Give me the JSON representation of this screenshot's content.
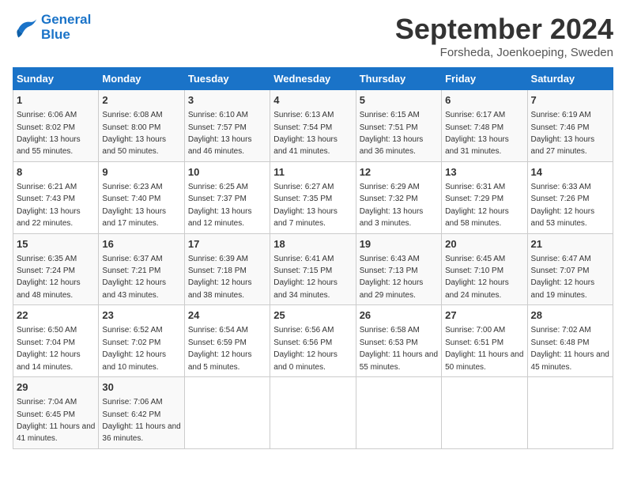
{
  "header": {
    "logo_line1": "General",
    "logo_line2": "Blue",
    "month": "September 2024",
    "location": "Forsheda, Joenkoeping, Sweden"
  },
  "weekdays": [
    "Sunday",
    "Monday",
    "Tuesday",
    "Wednesday",
    "Thursday",
    "Friday",
    "Saturday"
  ],
  "weeks": [
    [
      {
        "day": "1",
        "sunrise": "Sunrise: 6:06 AM",
        "sunset": "Sunset: 8:02 PM",
        "daylight": "Daylight: 13 hours and 55 minutes."
      },
      {
        "day": "2",
        "sunrise": "Sunrise: 6:08 AM",
        "sunset": "Sunset: 8:00 PM",
        "daylight": "Daylight: 13 hours and 50 minutes."
      },
      {
        "day": "3",
        "sunrise": "Sunrise: 6:10 AM",
        "sunset": "Sunset: 7:57 PM",
        "daylight": "Daylight: 13 hours and 46 minutes."
      },
      {
        "day": "4",
        "sunrise": "Sunrise: 6:13 AM",
        "sunset": "Sunset: 7:54 PM",
        "daylight": "Daylight: 13 hours and 41 minutes."
      },
      {
        "day": "5",
        "sunrise": "Sunrise: 6:15 AM",
        "sunset": "Sunset: 7:51 PM",
        "daylight": "Daylight: 13 hours and 36 minutes."
      },
      {
        "day": "6",
        "sunrise": "Sunrise: 6:17 AM",
        "sunset": "Sunset: 7:48 PM",
        "daylight": "Daylight: 13 hours and 31 minutes."
      },
      {
        "day": "7",
        "sunrise": "Sunrise: 6:19 AM",
        "sunset": "Sunset: 7:46 PM",
        "daylight": "Daylight: 13 hours and 27 minutes."
      }
    ],
    [
      {
        "day": "8",
        "sunrise": "Sunrise: 6:21 AM",
        "sunset": "Sunset: 7:43 PM",
        "daylight": "Daylight: 13 hours and 22 minutes."
      },
      {
        "day": "9",
        "sunrise": "Sunrise: 6:23 AM",
        "sunset": "Sunset: 7:40 PM",
        "daylight": "Daylight: 13 hours and 17 minutes."
      },
      {
        "day": "10",
        "sunrise": "Sunrise: 6:25 AM",
        "sunset": "Sunset: 7:37 PM",
        "daylight": "Daylight: 13 hours and 12 minutes."
      },
      {
        "day": "11",
        "sunrise": "Sunrise: 6:27 AM",
        "sunset": "Sunset: 7:35 PM",
        "daylight": "Daylight: 13 hours and 7 minutes."
      },
      {
        "day": "12",
        "sunrise": "Sunrise: 6:29 AM",
        "sunset": "Sunset: 7:32 PM",
        "daylight": "Daylight: 13 hours and 3 minutes."
      },
      {
        "day": "13",
        "sunrise": "Sunrise: 6:31 AM",
        "sunset": "Sunset: 7:29 PM",
        "daylight": "Daylight: 12 hours and 58 minutes."
      },
      {
        "day": "14",
        "sunrise": "Sunrise: 6:33 AM",
        "sunset": "Sunset: 7:26 PM",
        "daylight": "Daylight: 12 hours and 53 minutes."
      }
    ],
    [
      {
        "day": "15",
        "sunrise": "Sunrise: 6:35 AM",
        "sunset": "Sunset: 7:24 PM",
        "daylight": "Daylight: 12 hours and 48 minutes."
      },
      {
        "day": "16",
        "sunrise": "Sunrise: 6:37 AM",
        "sunset": "Sunset: 7:21 PM",
        "daylight": "Daylight: 12 hours and 43 minutes."
      },
      {
        "day": "17",
        "sunrise": "Sunrise: 6:39 AM",
        "sunset": "Sunset: 7:18 PM",
        "daylight": "Daylight: 12 hours and 38 minutes."
      },
      {
        "day": "18",
        "sunrise": "Sunrise: 6:41 AM",
        "sunset": "Sunset: 7:15 PM",
        "daylight": "Daylight: 12 hours and 34 minutes."
      },
      {
        "day": "19",
        "sunrise": "Sunrise: 6:43 AM",
        "sunset": "Sunset: 7:13 PM",
        "daylight": "Daylight: 12 hours and 29 minutes."
      },
      {
        "day": "20",
        "sunrise": "Sunrise: 6:45 AM",
        "sunset": "Sunset: 7:10 PM",
        "daylight": "Daylight: 12 hours and 24 minutes."
      },
      {
        "day": "21",
        "sunrise": "Sunrise: 6:47 AM",
        "sunset": "Sunset: 7:07 PM",
        "daylight": "Daylight: 12 hours and 19 minutes."
      }
    ],
    [
      {
        "day": "22",
        "sunrise": "Sunrise: 6:50 AM",
        "sunset": "Sunset: 7:04 PM",
        "daylight": "Daylight: 12 hours and 14 minutes."
      },
      {
        "day": "23",
        "sunrise": "Sunrise: 6:52 AM",
        "sunset": "Sunset: 7:02 PM",
        "daylight": "Daylight: 12 hours and 10 minutes."
      },
      {
        "day": "24",
        "sunrise": "Sunrise: 6:54 AM",
        "sunset": "Sunset: 6:59 PM",
        "daylight": "Daylight: 12 hours and 5 minutes."
      },
      {
        "day": "25",
        "sunrise": "Sunrise: 6:56 AM",
        "sunset": "Sunset: 6:56 PM",
        "daylight": "Daylight: 12 hours and 0 minutes."
      },
      {
        "day": "26",
        "sunrise": "Sunrise: 6:58 AM",
        "sunset": "Sunset: 6:53 PM",
        "daylight": "Daylight: 11 hours and 55 minutes."
      },
      {
        "day": "27",
        "sunrise": "Sunrise: 7:00 AM",
        "sunset": "Sunset: 6:51 PM",
        "daylight": "Daylight: 11 hours and 50 minutes."
      },
      {
        "day": "28",
        "sunrise": "Sunrise: 7:02 AM",
        "sunset": "Sunset: 6:48 PM",
        "daylight": "Daylight: 11 hours and 45 minutes."
      }
    ],
    [
      {
        "day": "29",
        "sunrise": "Sunrise: 7:04 AM",
        "sunset": "Sunset: 6:45 PM",
        "daylight": "Daylight: 11 hours and 41 minutes."
      },
      {
        "day": "30",
        "sunrise": "Sunrise: 7:06 AM",
        "sunset": "Sunset: 6:42 PM",
        "daylight": "Daylight: 11 hours and 36 minutes."
      },
      null,
      null,
      null,
      null,
      null
    ]
  ]
}
